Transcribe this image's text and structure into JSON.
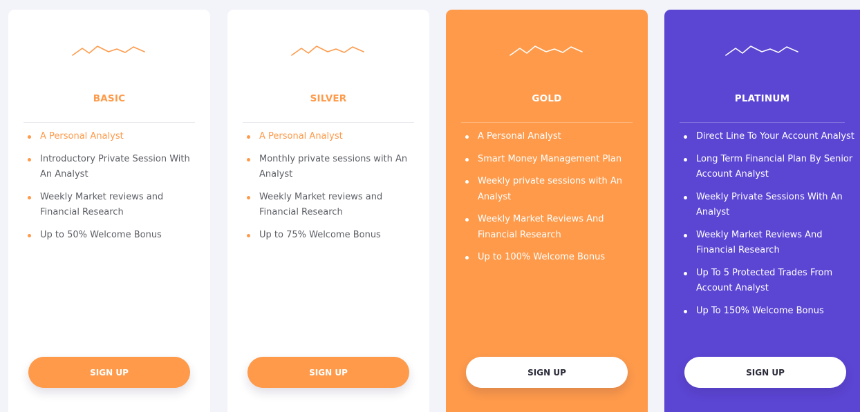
{
  "colors": {
    "accent_orange": "#fe9a4a",
    "accent_purple": "#5b45d3",
    "text_gray": "#5d5f66",
    "background": "#f3f3fa"
  },
  "plans": [
    {
      "title": "BASIC",
      "icon": "trend-wave-icon",
      "features": [
        "A Personal Analyst",
        "Introductory Private Session With An Analyst",
        "Weekly Market reviews and Financial Research",
        "Up to 50% Welcome Bonus"
      ],
      "button_label": "SIGN UP"
    },
    {
      "title": "SILVER",
      "icon": "trend-wave-icon",
      "features": [
        "A Personal Analyst",
        "Monthly private sessions with An Analyst",
        "Weekly Market reviews and Financial Research",
        "Up to 75% Welcome Bonus"
      ],
      "button_label": "SIGN UP"
    },
    {
      "title": "GOLD",
      "icon": "trend-wave-icon",
      "features": [
        "A Personal Analyst",
        "Smart Money Management Plan",
        "Weekly private sessions with An Analyst",
        "Weekly Market Reviews And Financial Research",
        "Up to 100% Welcome Bonus"
      ],
      "button_label": "SIGN UP"
    },
    {
      "title": "PLATINUM",
      "icon": "trend-wave-icon",
      "features": [
        "Direct Line To Your Account Analyst",
        "Long Term Financial Plan By Senior Account Analyst",
        "Weekly Private Sessions With An Analyst",
        "Weekly Market Reviews And Financial Research",
        "Up To 5 Protected Trades From Account Analyst",
        "Up To 150% Welcome Bonus"
      ],
      "button_label": "SIGN UP"
    }
  ]
}
